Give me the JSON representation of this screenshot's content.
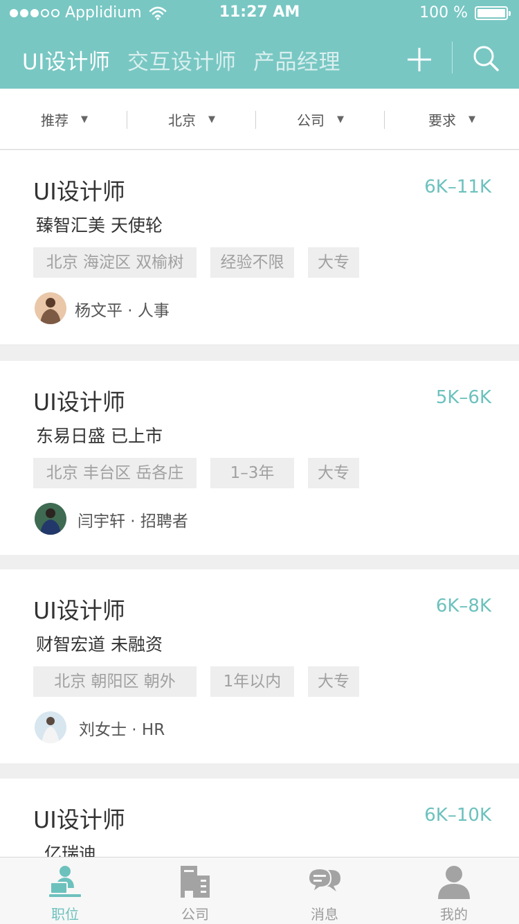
{
  "status_bar": {
    "carrier": "Applidium",
    "time": "11:27 AM",
    "battery": "100 %"
  },
  "nav": {
    "tabs": [
      {
        "label": "UI设计师",
        "active": true
      },
      {
        "label": "交互设计师",
        "active": false
      },
      {
        "label": "产品经理",
        "active": false
      }
    ],
    "add_icon": "plus-icon",
    "search_icon": "search-icon"
  },
  "filters": [
    {
      "label": "推荐"
    },
    {
      "label": "北京"
    },
    {
      "label": "公司"
    },
    {
      "label": "要求"
    }
  ],
  "jobs": [
    {
      "title": "UI设计师",
      "salary": "6K–11K",
      "company": "臻智汇美  天使轮",
      "tags": [
        "北京 海淀区 双榆树",
        "经验不限",
        "大专"
      ],
      "recruiter": "杨文平 · 人事"
    },
    {
      "title": "UI设计师",
      "salary": "5K–6K",
      "company": "东易日盛  已上市",
      "tags": [
        "北京 丰台区 岳各庄",
        "1–3年",
        "大专"
      ],
      "recruiter": "闫宇轩 · 招聘者"
    },
    {
      "title": "UI设计师",
      "salary": "6K–8K",
      "company": "财智宏道  未融资",
      "tags": [
        "北京 朝阳区   朝外",
        "1年以内",
        "大专"
      ],
      "recruiter": "刘女士 · HR"
    },
    {
      "title": "UI设计师",
      "salary": "6K–10K",
      "company": "亿瑞迪"
    }
  ],
  "tabbar": [
    {
      "label": "职位",
      "icon": "job-icon",
      "active": true
    },
    {
      "label": "公司",
      "icon": "building-icon",
      "active": false
    },
    {
      "label": "消息",
      "icon": "chat-icon",
      "active": false
    },
    {
      "label": "我的",
      "icon": "user-icon",
      "active": false
    }
  ],
  "colors": {
    "accent": "#78c7c3",
    "salary": "#6cc1bd",
    "tag_bg": "#eeeeee"
  }
}
